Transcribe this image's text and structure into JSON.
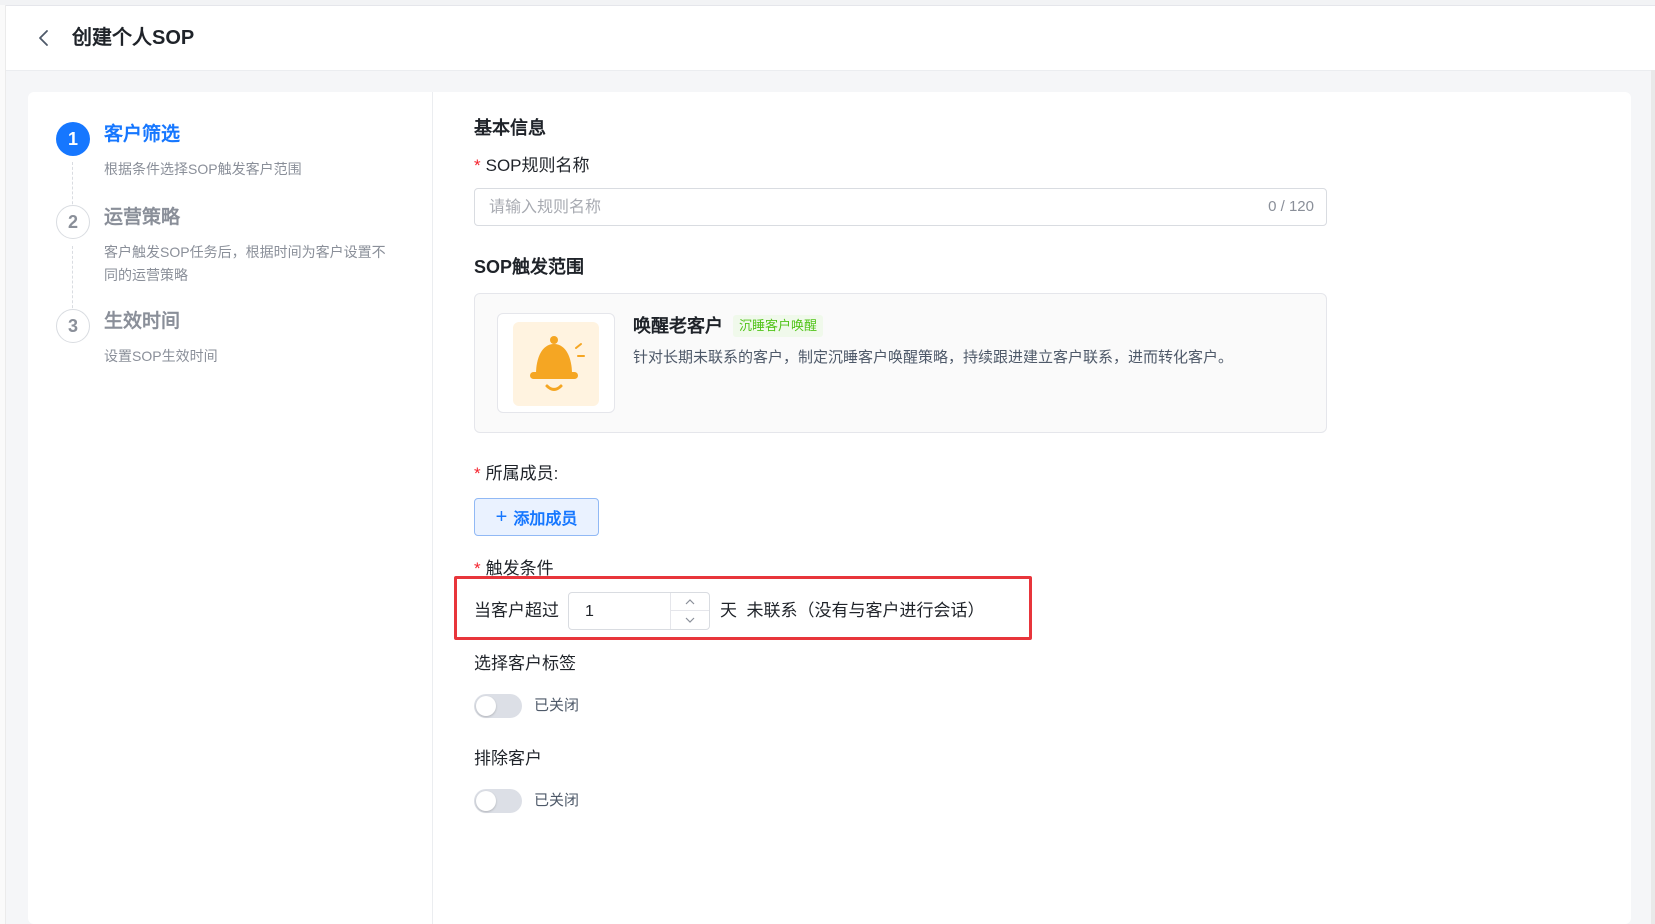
{
  "header": {
    "title": "创建个人SOP"
  },
  "steps": [
    {
      "number": "1",
      "title": "客户筛选",
      "desc": "根据条件选择SOP触发客户范围"
    },
    {
      "number": "2",
      "title": "运营策略",
      "desc": "客户触发SOP任务后，根据时间为客户设置不同的运营策略"
    },
    {
      "number": "3",
      "title": "生效时间",
      "desc": "设置SOP生效时间"
    }
  ],
  "basic": {
    "section_title": "基本信息",
    "name_label": "SOP规则名称",
    "required_mark": "*",
    "name_placeholder": "请输入规则名称",
    "name_value": "",
    "name_counter": "0 / 120"
  },
  "scope": {
    "section_title": "SOP触发范围",
    "scenario_name": "唤醒老客户",
    "scenario_tag": "沉睡客户唤醒",
    "scenario_desc": "针对长期未联系的客户，制定沉睡客户唤醒策略，持续跟进建立客户联系，进而转化客户。",
    "icon": "bell-icon"
  },
  "members": {
    "label": "所属成员:",
    "add_button": "添加成员"
  },
  "condition": {
    "label": "触发条件",
    "prefix": "当客户超过",
    "days_value": "1",
    "suffix": "天  未联系（没有与客户进行会话）"
  },
  "tags": {
    "label": "选择客户标签",
    "switch_state": "已关闭"
  },
  "exclude": {
    "label": "排除客户",
    "switch_state": "已关闭"
  },
  "colors": {
    "primary": "#1677ff",
    "highlight": "#e8353b",
    "tag_green": "#52c41a",
    "bell": "#f5a623"
  }
}
